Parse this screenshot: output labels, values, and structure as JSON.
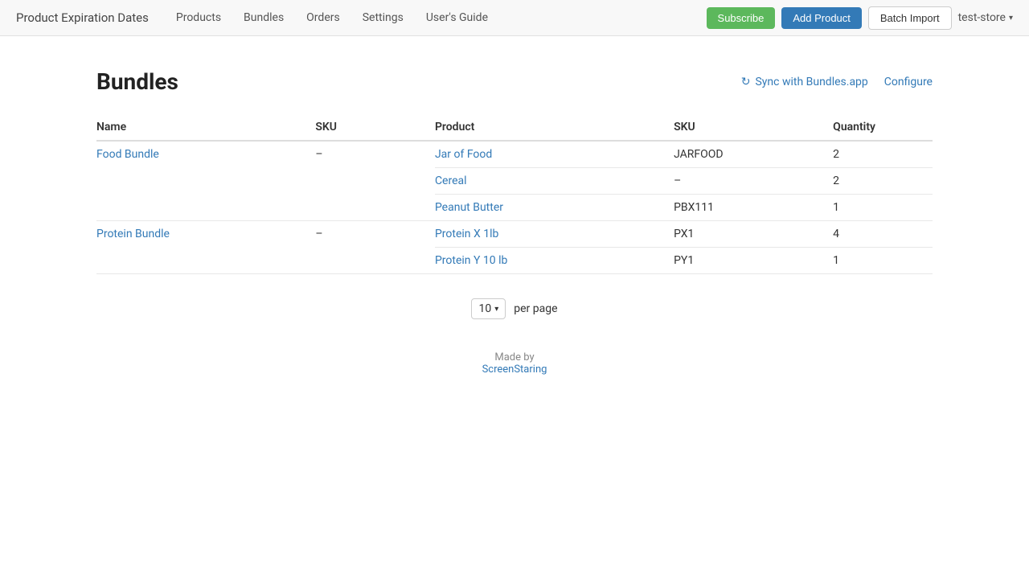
{
  "header": {
    "app_title": "Product Expiration Dates",
    "nav": [
      {
        "label": "Products",
        "id": "products"
      },
      {
        "label": "Bundles",
        "id": "bundles"
      },
      {
        "label": "Orders",
        "id": "orders"
      },
      {
        "label": "Settings",
        "id": "settings"
      },
      {
        "label": "User's Guide",
        "id": "users-guide"
      }
    ],
    "subscribe_label": "Subscribe",
    "add_product_label": "Add Product",
    "batch_import_label": "Batch Import",
    "store_name": "test-store"
  },
  "page": {
    "title": "Bundles",
    "sync_label": "Sync with Bundles.app",
    "configure_label": "Configure"
  },
  "table": {
    "headers": {
      "name": "Name",
      "sku": "SKU",
      "product": "Product",
      "product_sku": "SKU",
      "quantity": "Quantity"
    },
    "bundles": [
      {
        "name": "Food Bundle",
        "sku": "–",
        "products": [
          {
            "name": "Jar of Food",
            "sku": "JARFOOD",
            "quantity": "2"
          },
          {
            "name": "Cereal",
            "sku": "–",
            "quantity": "2"
          },
          {
            "name": "Peanut Butter",
            "sku": "PBX111",
            "quantity": "1"
          }
        ]
      },
      {
        "name": "Protein Bundle",
        "sku": "–",
        "products": [
          {
            "name": "Protein X 1lb",
            "sku": "PX1",
            "quantity": "4"
          },
          {
            "name": "Protein Y 10 lb",
            "sku": "PY1",
            "quantity": "1"
          }
        ]
      }
    ]
  },
  "pagination": {
    "per_page_value": "10",
    "per_page_label": "per page"
  },
  "footer": {
    "made_by_label": "Made by",
    "company_name": "ScreenStaring",
    "company_url": "#"
  }
}
